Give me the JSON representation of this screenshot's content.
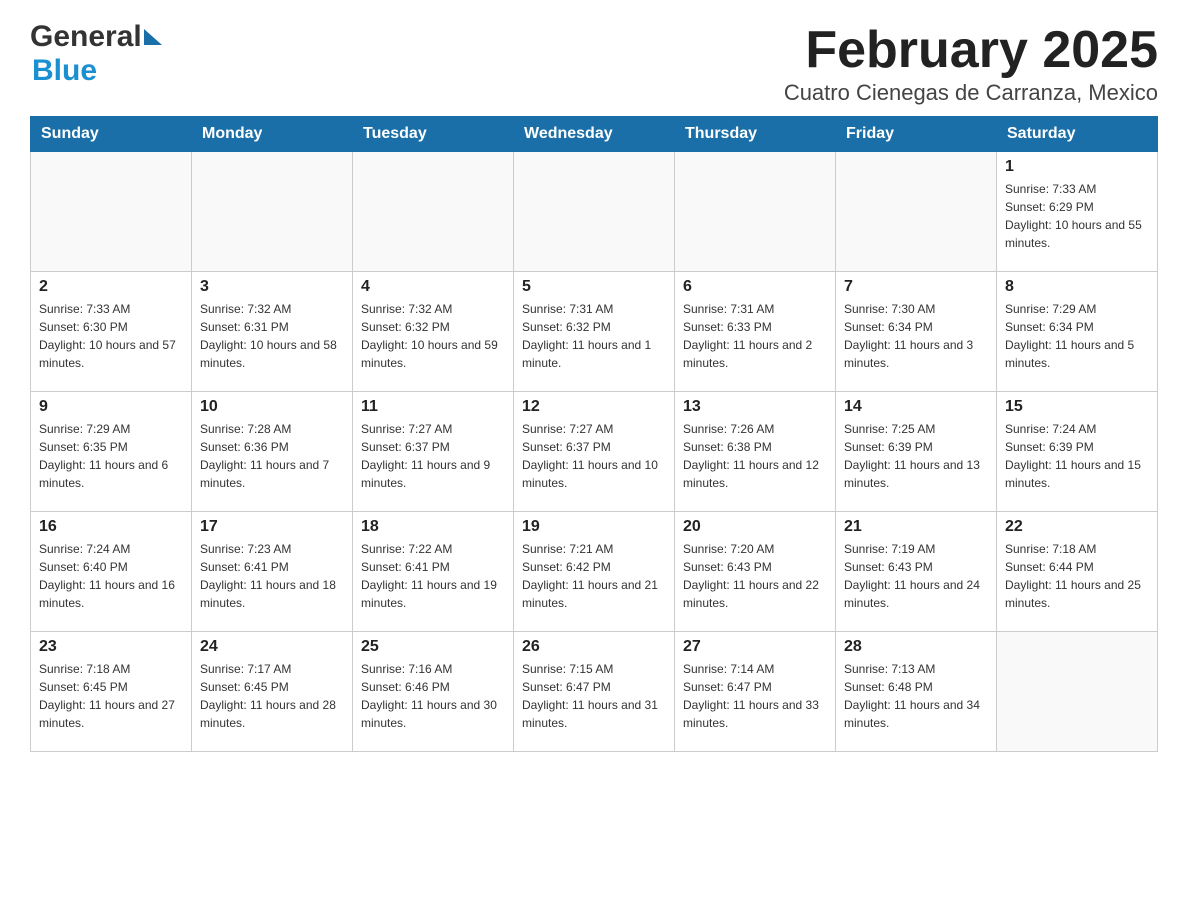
{
  "header": {
    "title": "February 2025",
    "subtitle": "Cuatro Cienegas de Carranza, Mexico",
    "logo": {
      "general": "General",
      "blue": "Blue"
    }
  },
  "calendar": {
    "days_of_week": [
      "Sunday",
      "Monday",
      "Tuesday",
      "Wednesday",
      "Thursday",
      "Friday",
      "Saturday"
    ],
    "weeks": [
      [
        {
          "day": "",
          "sunrise": "",
          "sunset": "",
          "daylight": ""
        },
        {
          "day": "",
          "sunrise": "",
          "sunset": "",
          "daylight": ""
        },
        {
          "day": "",
          "sunrise": "",
          "sunset": "",
          "daylight": ""
        },
        {
          "day": "",
          "sunrise": "",
          "sunset": "",
          "daylight": ""
        },
        {
          "day": "",
          "sunrise": "",
          "sunset": "",
          "daylight": ""
        },
        {
          "day": "",
          "sunrise": "",
          "sunset": "",
          "daylight": ""
        },
        {
          "day": "1",
          "sunrise": "Sunrise: 7:33 AM",
          "sunset": "Sunset: 6:29 PM",
          "daylight": "Daylight: 10 hours and 55 minutes."
        }
      ],
      [
        {
          "day": "2",
          "sunrise": "Sunrise: 7:33 AM",
          "sunset": "Sunset: 6:30 PM",
          "daylight": "Daylight: 10 hours and 57 minutes."
        },
        {
          "day": "3",
          "sunrise": "Sunrise: 7:32 AM",
          "sunset": "Sunset: 6:31 PM",
          "daylight": "Daylight: 10 hours and 58 minutes."
        },
        {
          "day": "4",
          "sunrise": "Sunrise: 7:32 AM",
          "sunset": "Sunset: 6:32 PM",
          "daylight": "Daylight: 10 hours and 59 minutes."
        },
        {
          "day": "5",
          "sunrise": "Sunrise: 7:31 AM",
          "sunset": "Sunset: 6:32 PM",
          "daylight": "Daylight: 11 hours and 1 minute."
        },
        {
          "day": "6",
          "sunrise": "Sunrise: 7:31 AM",
          "sunset": "Sunset: 6:33 PM",
          "daylight": "Daylight: 11 hours and 2 minutes."
        },
        {
          "day": "7",
          "sunrise": "Sunrise: 7:30 AM",
          "sunset": "Sunset: 6:34 PM",
          "daylight": "Daylight: 11 hours and 3 minutes."
        },
        {
          "day": "8",
          "sunrise": "Sunrise: 7:29 AM",
          "sunset": "Sunset: 6:34 PM",
          "daylight": "Daylight: 11 hours and 5 minutes."
        }
      ],
      [
        {
          "day": "9",
          "sunrise": "Sunrise: 7:29 AM",
          "sunset": "Sunset: 6:35 PM",
          "daylight": "Daylight: 11 hours and 6 minutes."
        },
        {
          "day": "10",
          "sunrise": "Sunrise: 7:28 AM",
          "sunset": "Sunset: 6:36 PM",
          "daylight": "Daylight: 11 hours and 7 minutes."
        },
        {
          "day": "11",
          "sunrise": "Sunrise: 7:27 AM",
          "sunset": "Sunset: 6:37 PM",
          "daylight": "Daylight: 11 hours and 9 minutes."
        },
        {
          "day": "12",
          "sunrise": "Sunrise: 7:27 AM",
          "sunset": "Sunset: 6:37 PM",
          "daylight": "Daylight: 11 hours and 10 minutes."
        },
        {
          "day": "13",
          "sunrise": "Sunrise: 7:26 AM",
          "sunset": "Sunset: 6:38 PM",
          "daylight": "Daylight: 11 hours and 12 minutes."
        },
        {
          "day": "14",
          "sunrise": "Sunrise: 7:25 AM",
          "sunset": "Sunset: 6:39 PM",
          "daylight": "Daylight: 11 hours and 13 minutes."
        },
        {
          "day": "15",
          "sunrise": "Sunrise: 7:24 AM",
          "sunset": "Sunset: 6:39 PM",
          "daylight": "Daylight: 11 hours and 15 minutes."
        }
      ],
      [
        {
          "day": "16",
          "sunrise": "Sunrise: 7:24 AM",
          "sunset": "Sunset: 6:40 PM",
          "daylight": "Daylight: 11 hours and 16 minutes."
        },
        {
          "day": "17",
          "sunrise": "Sunrise: 7:23 AM",
          "sunset": "Sunset: 6:41 PM",
          "daylight": "Daylight: 11 hours and 18 minutes."
        },
        {
          "day": "18",
          "sunrise": "Sunrise: 7:22 AM",
          "sunset": "Sunset: 6:41 PM",
          "daylight": "Daylight: 11 hours and 19 minutes."
        },
        {
          "day": "19",
          "sunrise": "Sunrise: 7:21 AM",
          "sunset": "Sunset: 6:42 PM",
          "daylight": "Daylight: 11 hours and 21 minutes."
        },
        {
          "day": "20",
          "sunrise": "Sunrise: 7:20 AM",
          "sunset": "Sunset: 6:43 PM",
          "daylight": "Daylight: 11 hours and 22 minutes."
        },
        {
          "day": "21",
          "sunrise": "Sunrise: 7:19 AM",
          "sunset": "Sunset: 6:43 PM",
          "daylight": "Daylight: 11 hours and 24 minutes."
        },
        {
          "day": "22",
          "sunrise": "Sunrise: 7:18 AM",
          "sunset": "Sunset: 6:44 PM",
          "daylight": "Daylight: 11 hours and 25 minutes."
        }
      ],
      [
        {
          "day": "23",
          "sunrise": "Sunrise: 7:18 AM",
          "sunset": "Sunset: 6:45 PM",
          "daylight": "Daylight: 11 hours and 27 minutes."
        },
        {
          "day": "24",
          "sunrise": "Sunrise: 7:17 AM",
          "sunset": "Sunset: 6:45 PM",
          "daylight": "Daylight: 11 hours and 28 minutes."
        },
        {
          "day": "25",
          "sunrise": "Sunrise: 7:16 AM",
          "sunset": "Sunset: 6:46 PM",
          "daylight": "Daylight: 11 hours and 30 minutes."
        },
        {
          "day": "26",
          "sunrise": "Sunrise: 7:15 AM",
          "sunset": "Sunset: 6:47 PM",
          "daylight": "Daylight: 11 hours and 31 minutes."
        },
        {
          "day": "27",
          "sunrise": "Sunrise: 7:14 AM",
          "sunset": "Sunset: 6:47 PM",
          "daylight": "Daylight: 11 hours and 33 minutes."
        },
        {
          "day": "28",
          "sunrise": "Sunrise: 7:13 AM",
          "sunset": "Sunset: 6:48 PM",
          "daylight": "Daylight: 11 hours and 34 minutes."
        },
        {
          "day": "",
          "sunrise": "",
          "sunset": "",
          "daylight": ""
        }
      ]
    ]
  }
}
